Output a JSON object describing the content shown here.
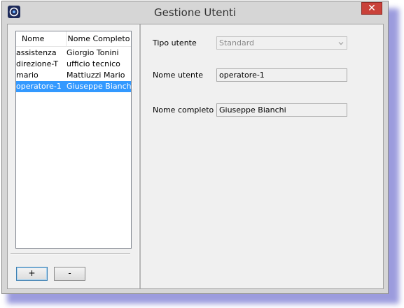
{
  "window": {
    "title": "Gestione Utenti",
    "close_label": "✕"
  },
  "user_list": {
    "columns": [
      "Nome",
      "Nome Completo"
    ],
    "rows": [
      {
        "name": "assistenza",
        "full_name": "Giorgio Tonini"
      },
      {
        "name": "direzione-T",
        "full_name": "ufficio tecnico"
      },
      {
        "name": "mario",
        "full_name": "Mattiuzzi Mario"
      },
      {
        "name": "operatore-1",
        "full_name": "Giuseppe Bianchi"
      }
    ],
    "selected_index": 3
  },
  "buttons": {
    "add_label": "+",
    "remove_label": "-"
  },
  "form": {
    "user_type_label": "Tipo utente",
    "user_type_value": "Standard",
    "username_label": "Nome utente",
    "username_value": "operatore-1",
    "fullname_label": "Nome completo",
    "fullname_value": "Giuseppe Bianchi"
  },
  "colors": {
    "selection": "#3399ff",
    "close_button": "#c9413a"
  }
}
